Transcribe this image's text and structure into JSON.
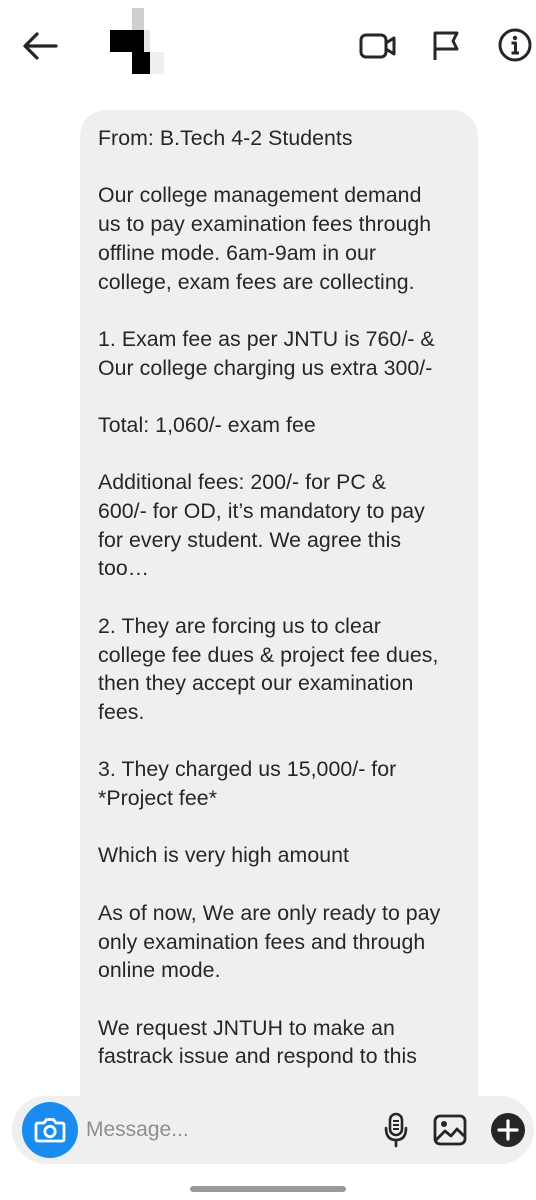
{
  "header": {
    "back_icon": "arrow-left-icon",
    "video_icon": "video-camera-icon",
    "flag_icon": "flag-icon",
    "info_icon": "info-circle-icon"
  },
  "message": {
    "paragraphs": [
      "From: B.Tech 4-2 Students",
      "Our college management demand\nus to pay examination fees through\noffline mode. 6am-9am in our\ncollege, exam fees are collecting.",
      "1. Exam fee as per JNTU is 760/- &\nOur college charging us extra 300/-",
      "Total: 1,060/- exam fee",
      "Additional fees: 200/- for PC &\n600/- for OD, it’s mandatory to pay\nfor every student. We agree this\ntoo…",
      "2. They are forcing us to clear\ncollege fee dues & project fee dues,\nthen they accept our examination\nfees.",
      "3. They charged us 15,000/- for\n*Project fee*",
      "Which is very high amount",
      "As of now, We are only ready to pay\nonly examination fees and through\nonline mode.",
      "We request JNTUH to make an\nfastrack issue and respond to this"
    ]
  },
  "composer": {
    "placeholder": "Message...",
    "camera_icon": "camera-icon",
    "mic_icon": "microphone-icon",
    "gallery_icon": "image-gallery-icon",
    "plus_icon": "plus-circle-icon"
  },
  "colors": {
    "accent": "#1a8cf0",
    "bubble": "#efefef",
    "text": "#262626",
    "placeholder": "#8e8e8e"
  }
}
